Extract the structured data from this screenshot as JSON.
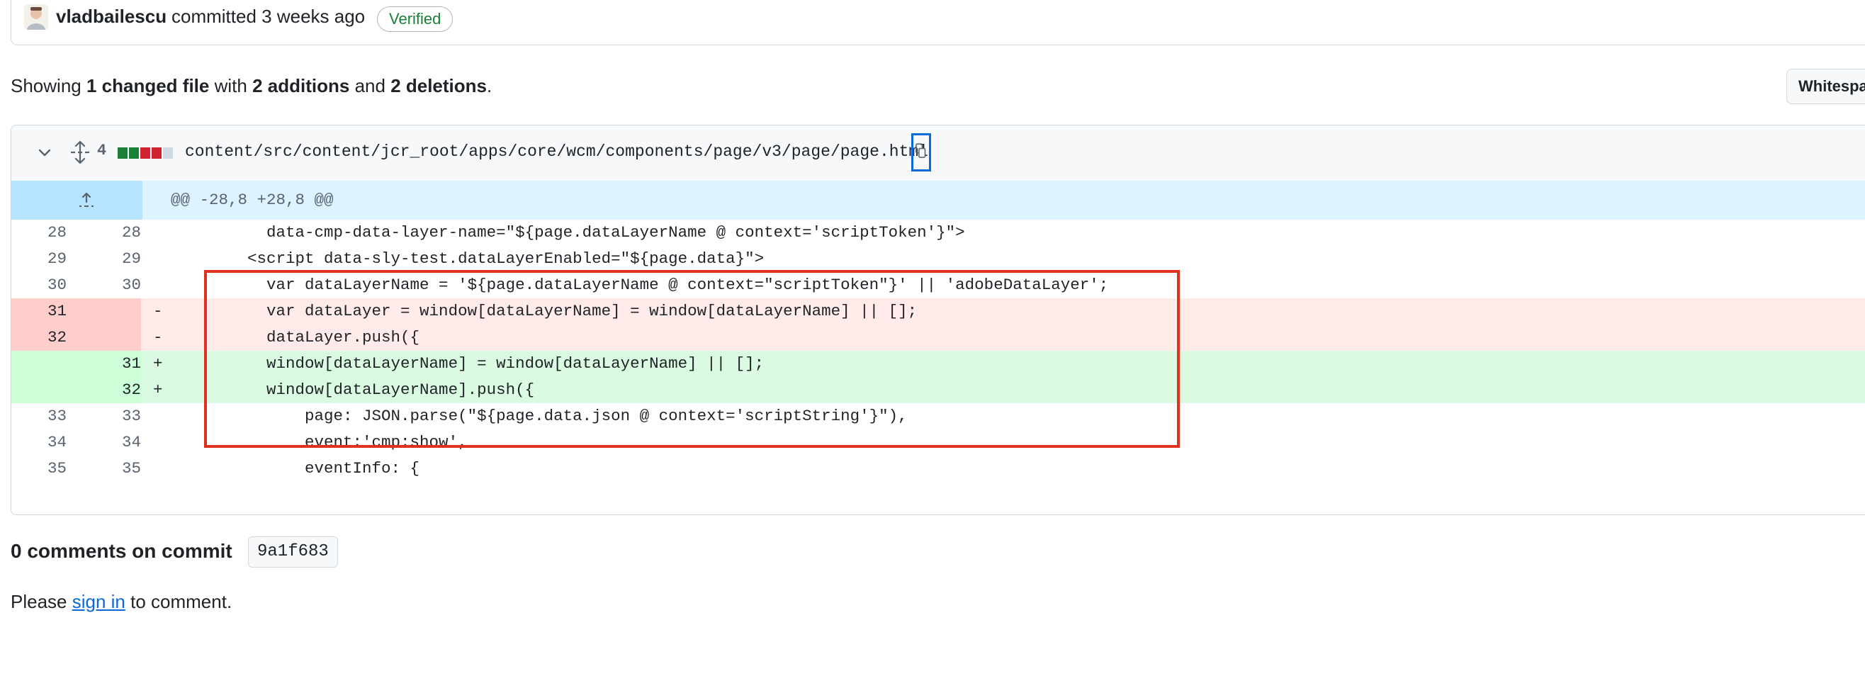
{
  "commit": {
    "author": "vladbailescu",
    "committed_text": "committed 3 weeks ago",
    "verified_label": "Verified"
  },
  "summary": {
    "prefix": "Showing",
    "files": "1 changed file",
    "with": "with",
    "additions": "2 additions",
    "and": "and",
    "deletions": "2 deletions",
    "suffix": "."
  },
  "toolbar": {
    "whitespace_label": "Whitespace"
  },
  "file": {
    "change_count": "4",
    "diffstat": [
      "#1a7f37",
      "#1a7f37",
      "#cf222e",
      "#cf222e",
      "#d1d9e0"
    ],
    "path": "content/src/content/jcr_root/apps/core/wcm/components/page/v3/page/page.html"
  },
  "diff": {
    "hunk_header": "@@ -28,8 +28,8 @@",
    "lines": [
      {
        "type": "ctx",
        "old": "28",
        "new": "28",
        "sign": "",
        "code": "          data-cmp-data-layer-name=\"${page.dataLayerName @ context='scriptToken'}\">"
      },
      {
        "type": "ctx",
        "old": "29",
        "new": "29",
        "sign": "",
        "code": "        <script data-sly-test.dataLayerEnabled=\"${page.data}\">"
      },
      {
        "type": "ctx",
        "old": "30",
        "new": "30",
        "sign": "",
        "code": "          var dataLayerName = '${page.dataLayerName @ context=\"scriptToken\"}' || 'adobeDataLayer';"
      },
      {
        "type": "del",
        "old": "31",
        "new": "",
        "sign": "-",
        "code": "          var dataLayer = window[dataLayerName] = window[dataLayerName] || [];"
      },
      {
        "type": "del",
        "old": "32",
        "new": "",
        "sign": "-",
        "code": "          dataLayer.push({"
      },
      {
        "type": "add",
        "old": "",
        "new": "31",
        "sign": "+",
        "code": "          window[dataLayerName] = window[dataLayerName] || [];"
      },
      {
        "type": "add",
        "old": "",
        "new": "32",
        "sign": "+",
        "code": "          window[dataLayerName].push({"
      },
      {
        "type": "ctx",
        "old": "33",
        "new": "33",
        "sign": "",
        "code": "              page: JSON.parse(\"${page.data.json @ context='scriptString'}\"),"
      },
      {
        "type": "ctx",
        "old": "34",
        "new": "34",
        "sign": "",
        "code": "              event:'cmp:show',"
      },
      {
        "type": "ctx",
        "old": "35",
        "new": "35",
        "sign": "",
        "code": "              eventInfo: {"
      }
    ]
  },
  "comments": {
    "title": "0 comments on commit",
    "sha": "9a1f683",
    "please": "Please",
    "sign_in": "sign in",
    "to_comment": "to comment."
  }
}
